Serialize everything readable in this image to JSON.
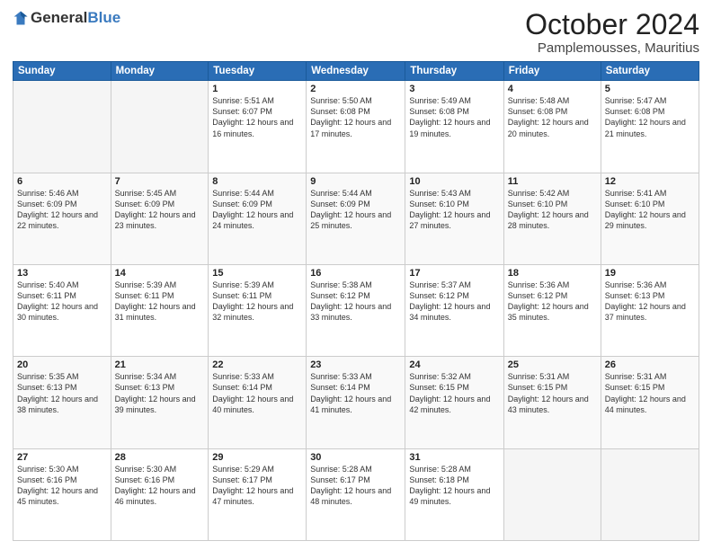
{
  "logo": {
    "text_general": "General",
    "text_blue": "Blue"
  },
  "header": {
    "month": "October 2024",
    "location": "Pamplemousses, Mauritius"
  },
  "days_of_week": [
    "Sunday",
    "Monday",
    "Tuesday",
    "Wednesday",
    "Thursday",
    "Friday",
    "Saturday"
  ],
  "weeks": [
    [
      {
        "day": "",
        "empty": true
      },
      {
        "day": "",
        "empty": true
      },
      {
        "day": "1",
        "sunrise": "5:51 AM",
        "sunset": "6:07 PM",
        "daylight": "12 hours and 16 minutes."
      },
      {
        "day": "2",
        "sunrise": "5:50 AM",
        "sunset": "6:08 PM",
        "daylight": "12 hours and 17 minutes."
      },
      {
        "day": "3",
        "sunrise": "5:49 AM",
        "sunset": "6:08 PM",
        "daylight": "12 hours and 19 minutes."
      },
      {
        "day": "4",
        "sunrise": "5:48 AM",
        "sunset": "6:08 PM",
        "daylight": "12 hours and 20 minutes."
      },
      {
        "day": "5",
        "sunrise": "5:47 AM",
        "sunset": "6:08 PM",
        "daylight": "12 hours and 21 minutes."
      }
    ],
    [
      {
        "day": "6",
        "sunrise": "5:46 AM",
        "sunset": "6:09 PM",
        "daylight": "12 hours and 22 minutes."
      },
      {
        "day": "7",
        "sunrise": "5:45 AM",
        "sunset": "6:09 PM",
        "daylight": "12 hours and 23 minutes."
      },
      {
        "day": "8",
        "sunrise": "5:44 AM",
        "sunset": "6:09 PM",
        "daylight": "12 hours and 24 minutes."
      },
      {
        "day": "9",
        "sunrise": "5:44 AM",
        "sunset": "6:09 PM",
        "daylight": "12 hours and 25 minutes."
      },
      {
        "day": "10",
        "sunrise": "5:43 AM",
        "sunset": "6:10 PM",
        "daylight": "12 hours and 27 minutes."
      },
      {
        "day": "11",
        "sunrise": "5:42 AM",
        "sunset": "6:10 PM",
        "daylight": "12 hours and 28 minutes."
      },
      {
        "day": "12",
        "sunrise": "5:41 AM",
        "sunset": "6:10 PM",
        "daylight": "12 hours and 29 minutes."
      }
    ],
    [
      {
        "day": "13",
        "sunrise": "5:40 AM",
        "sunset": "6:11 PM",
        "daylight": "12 hours and 30 minutes."
      },
      {
        "day": "14",
        "sunrise": "5:39 AM",
        "sunset": "6:11 PM",
        "daylight": "12 hours and 31 minutes."
      },
      {
        "day": "15",
        "sunrise": "5:39 AM",
        "sunset": "6:11 PM",
        "daylight": "12 hours and 32 minutes."
      },
      {
        "day": "16",
        "sunrise": "5:38 AM",
        "sunset": "6:12 PM",
        "daylight": "12 hours and 33 minutes."
      },
      {
        "day": "17",
        "sunrise": "5:37 AM",
        "sunset": "6:12 PM",
        "daylight": "12 hours and 34 minutes."
      },
      {
        "day": "18",
        "sunrise": "5:36 AM",
        "sunset": "6:12 PM",
        "daylight": "12 hours and 35 minutes."
      },
      {
        "day": "19",
        "sunrise": "5:36 AM",
        "sunset": "6:13 PM",
        "daylight": "12 hours and 37 minutes."
      }
    ],
    [
      {
        "day": "20",
        "sunrise": "5:35 AM",
        "sunset": "6:13 PM",
        "daylight": "12 hours and 38 minutes."
      },
      {
        "day": "21",
        "sunrise": "5:34 AM",
        "sunset": "6:13 PM",
        "daylight": "12 hours and 39 minutes."
      },
      {
        "day": "22",
        "sunrise": "5:33 AM",
        "sunset": "6:14 PM",
        "daylight": "12 hours and 40 minutes."
      },
      {
        "day": "23",
        "sunrise": "5:33 AM",
        "sunset": "6:14 PM",
        "daylight": "12 hours and 41 minutes."
      },
      {
        "day": "24",
        "sunrise": "5:32 AM",
        "sunset": "6:15 PM",
        "daylight": "12 hours and 42 minutes."
      },
      {
        "day": "25",
        "sunrise": "5:31 AM",
        "sunset": "6:15 PM",
        "daylight": "12 hours and 43 minutes."
      },
      {
        "day": "26",
        "sunrise": "5:31 AM",
        "sunset": "6:15 PM",
        "daylight": "12 hours and 44 minutes."
      }
    ],
    [
      {
        "day": "27",
        "sunrise": "5:30 AM",
        "sunset": "6:16 PM",
        "daylight": "12 hours and 45 minutes."
      },
      {
        "day": "28",
        "sunrise": "5:30 AM",
        "sunset": "6:16 PM",
        "daylight": "12 hours and 46 minutes."
      },
      {
        "day": "29",
        "sunrise": "5:29 AM",
        "sunset": "6:17 PM",
        "daylight": "12 hours and 47 minutes."
      },
      {
        "day": "30",
        "sunrise": "5:28 AM",
        "sunset": "6:17 PM",
        "daylight": "12 hours and 48 minutes."
      },
      {
        "day": "31",
        "sunrise": "5:28 AM",
        "sunset": "6:18 PM",
        "daylight": "12 hours and 49 minutes."
      },
      {
        "day": "",
        "empty": true
      },
      {
        "day": "",
        "empty": true
      }
    ]
  ]
}
